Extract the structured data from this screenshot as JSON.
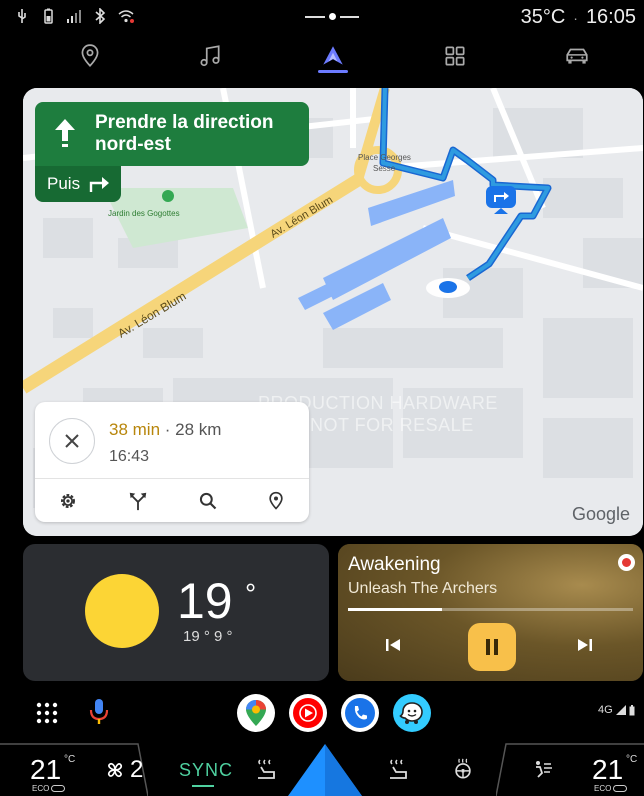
{
  "status_bar": {
    "temperature": "35°C",
    "separator": "·",
    "time": "16:05"
  },
  "nav": {
    "active": "navigation",
    "items": [
      "location-pin-icon",
      "music-note-icon",
      "navigation-arrow-icon",
      "apps-grid-icon",
      "car-icon"
    ],
    "accent_color": "#6c7bff"
  },
  "navigation": {
    "instruction": "Prendre la direction nord-est",
    "instruction_line1": "Prendre la direction",
    "instruction_line2": "nord-est",
    "then_label": "Puis",
    "eta_duration": "38 min",
    "eta_separator": "·",
    "eta_distance": "28 km",
    "arrival_time": "16:43",
    "map_labels": {
      "street_1": "Av. Léon Blum",
      "street_2": "Av. Léon Blum",
      "place_1": "Place Georges",
      "place_2": "Sesse",
      "park": "Jardin des Gogottes"
    },
    "attribution": "Google",
    "watermark_line1": "PRODUCTION HARDWARE",
    "watermark_line2": "NOT FOR RESALE",
    "banner_color": "#1e7d3e",
    "route_color": "#2f9be0"
  },
  "weather": {
    "temperature": "19",
    "degree": "°",
    "range": "19 ° 9 °",
    "sun_color": "#fcd535"
  },
  "media": {
    "title": "Awakening",
    "artist": "Unleash The Archers",
    "progress": 0.33,
    "play_button_color": "#f8c04a"
  },
  "dock": {
    "apps": [
      "google-maps-app-icon",
      "youtube-music-app-icon",
      "phone-app-icon",
      "waze-app-icon"
    ],
    "network": "4G"
  },
  "climate": {
    "left_temp": "21",
    "left_unit": "°C",
    "right_temp": "21",
    "right_unit": "°C",
    "eco_label": "ECO",
    "fan_speed": "2",
    "sync_label": "SYNC",
    "sync_color": "#4fd1a0"
  }
}
